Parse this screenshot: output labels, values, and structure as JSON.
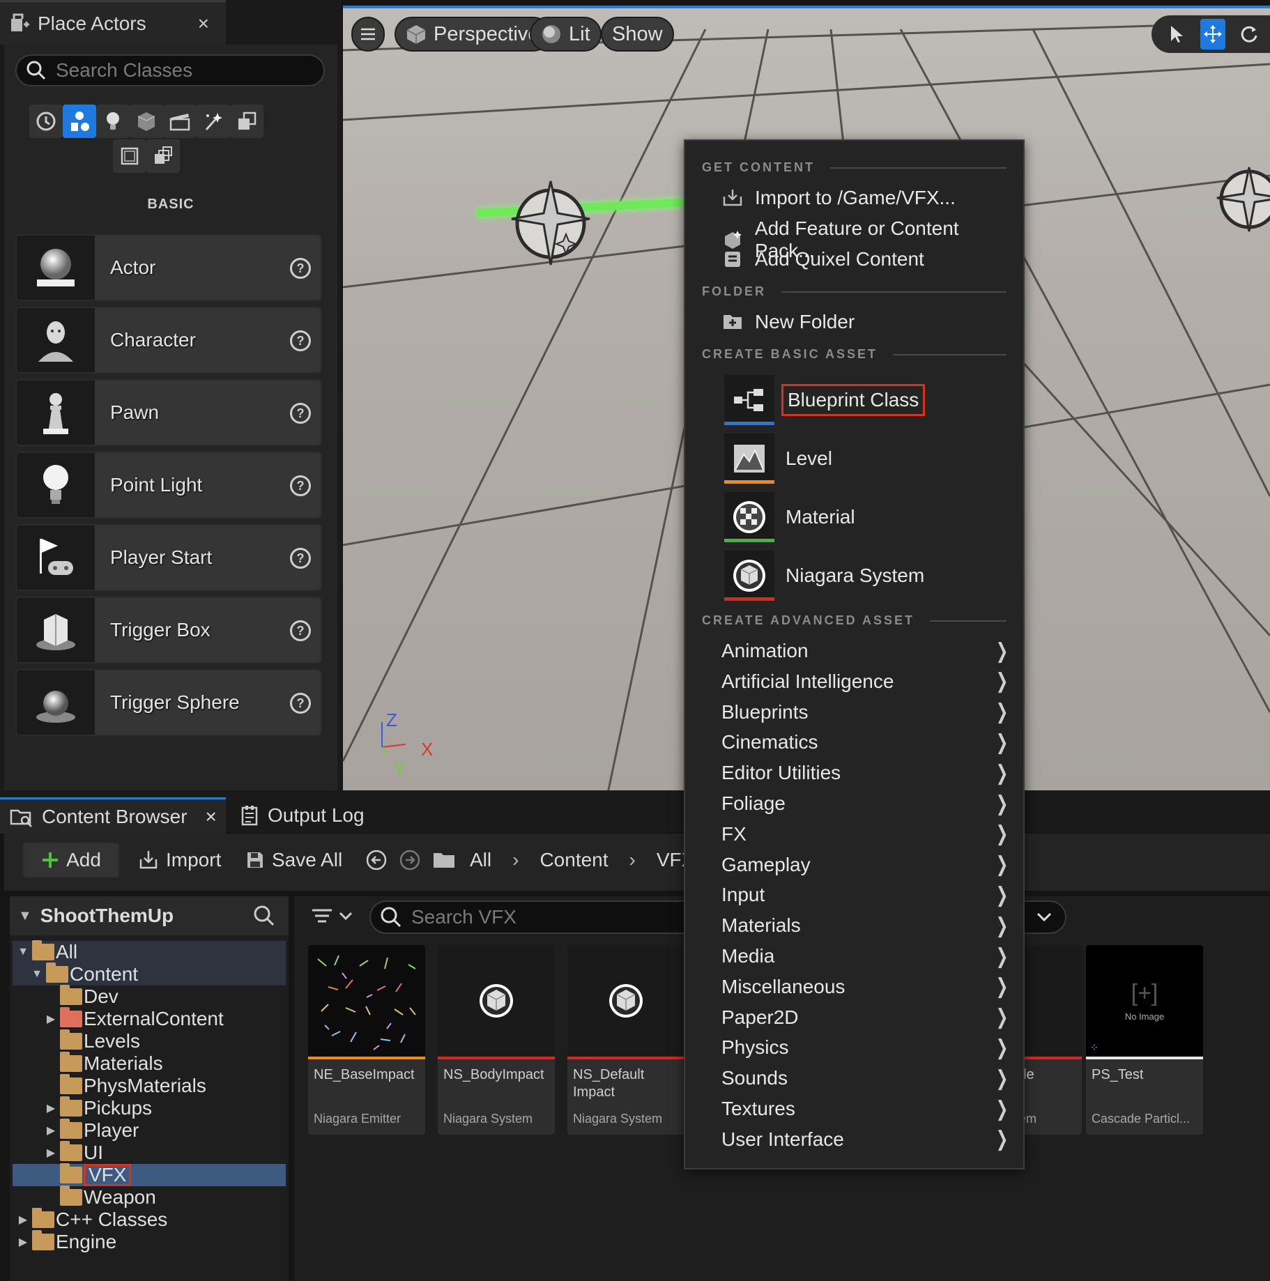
{
  "place_actors": {
    "tab_title": "Place Actors",
    "close_glyph": "×",
    "search_placeholder": "Search Classes",
    "category_label": "BASIC",
    "categories": [
      "recent-icon",
      "basic-icon",
      "lights-icon",
      "shapes-icon",
      "cinematic-icon",
      "visual-effects-icon",
      "geometry-icon",
      "volumes-icon",
      "all-classes-icon"
    ],
    "actors": [
      {
        "label": "Actor",
        "icon": "actor-sphere-icon"
      },
      {
        "label": "Character",
        "icon": "character-icon"
      },
      {
        "label": "Pawn",
        "icon": "pawn-icon"
      },
      {
        "label": "Point Light",
        "icon": "light-bulb-icon"
      },
      {
        "label": "Player Start",
        "icon": "player-start-icon"
      },
      {
        "label": "Trigger Box",
        "icon": "trigger-box-icon"
      },
      {
        "label": "Trigger Sphere",
        "icon": "trigger-sphere-icon"
      }
    ],
    "help_glyph": "?"
  },
  "viewport": {
    "perspective_label": "Perspective",
    "lit_label": "Lit",
    "show_label": "Show",
    "axes": {
      "z": "Z",
      "x": "X",
      "y": "Y"
    }
  },
  "context_menu": {
    "sections": {
      "get_content": "GET CONTENT",
      "folder": "FOLDER",
      "create_basic": "CREATE BASIC ASSET",
      "create_advanced": "CREATE ADVANCED ASSET"
    },
    "get_content_items": [
      {
        "label": "Import to /Game/VFX...",
        "icon": "import-icon"
      },
      {
        "label": "Add Feature or Content Pack...",
        "icon": "feature-pack-icon"
      },
      {
        "label": "Add Quixel Content",
        "icon": "quixel-icon"
      }
    ],
    "folder_items": [
      {
        "label": "New Folder",
        "icon": "new-folder-icon"
      }
    ],
    "basic_assets": [
      {
        "label": "Blueprint Class",
        "bar_color": "#2f74d8",
        "highlighted": true
      },
      {
        "label": "Level",
        "bar_color": "#f08a1c",
        "highlighted": false
      },
      {
        "label": "Material",
        "bar_color": "#42b83a",
        "highlighted": false
      },
      {
        "label": "Niagara System",
        "bar_color": "#d8281f",
        "highlighted": false
      }
    ],
    "advanced_assets": [
      "Animation",
      "Artificial Intelligence",
      "Blueprints",
      "Cinematics",
      "Editor Utilities",
      "Foliage",
      "FX",
      "Gameplay",
      "Input",
      "Materials",
      "Media",
      "Miscellaneous",
      "Paper2D",
      "Physics",
      "Sounds",
      "Textures",
      "User Interface"
    ]
  },
  "content_browser": {
    "tabs": [
      {
        "label": "Content Browser",
        "active": true
      },
      {
        "label": "Output Log",
        "active": false
      }
    ],
    "toolbar": {
      "add_label": "Add",
      "import_label": "Import",
      "save_all_label": "Save All"
    },
    "breadcrumb": [
      "All",
      "Content",
      "VFX"
    ],
    "project_name": "ShootThemUp",
    "search_placeholder": "Search VFX",
    "tree": [
      {
        "label": "All",
        "depth": 0,
        "expanded": true
      },
      {
        "label": "Content",
        "depth": 1,
        "expanded": true
      },
      {
        "label": "Dev",
        "depth": 2
      },
      {
        "label": "ExternalContent",
        "depth": 2,
        "collapsed": true
      },
      {
        "label": "Levels",
        "depth": 2
      },
      {
        "label": "Materials",
        "depth": 2
      },
      {
        "label": "PhysMaterials",
        "depth": 2
      },
      {
        "label": "Pickups",
        "depth": 2,
        "collapsed": true
      },
      {
        "label": "Player",
        "depth": 2,
        "collapsed": true
      },
      {
        "label": "UI",
        "depth": 2,
        "collapsed": true
      },
      {
        "label": "VFX",
        "depth": 2,
        "selected": true
      },
      {
        "label": "Weapon",
        "depth": 2
      },
      {
        "label": "C++ Classes",
        "depth": 0,
        "collapsed": true
      },
      {
        "label": "Engine",
        "depth": 0,
        "collapsed": true
      }
    ],
    "assets": [
      {
        "name": "NE_BaseImpact",
        "type": "Niagara Emitter",
        "bar_color": "#f08a1c"
      },
      {
        "name": "NS_BodyImpact",
        "type": "Niagara System",
        "bar_color": "#d8281f"
      },
      {
        "name": "NS_Default Impact",
        "type": "Niagara System",
        "bar_color": "#d8281f"
      },
      {
        "name": "ctile",
        "type": "stem",
        "bar_color": "#d8281f"
      },
      {
        "name": "PS_Test",
        "type": "Cascade Particl...",
        "bar_color": "#e8e8e8",
        "thumb_text": "No Image"
      }
    ]
  }
}
